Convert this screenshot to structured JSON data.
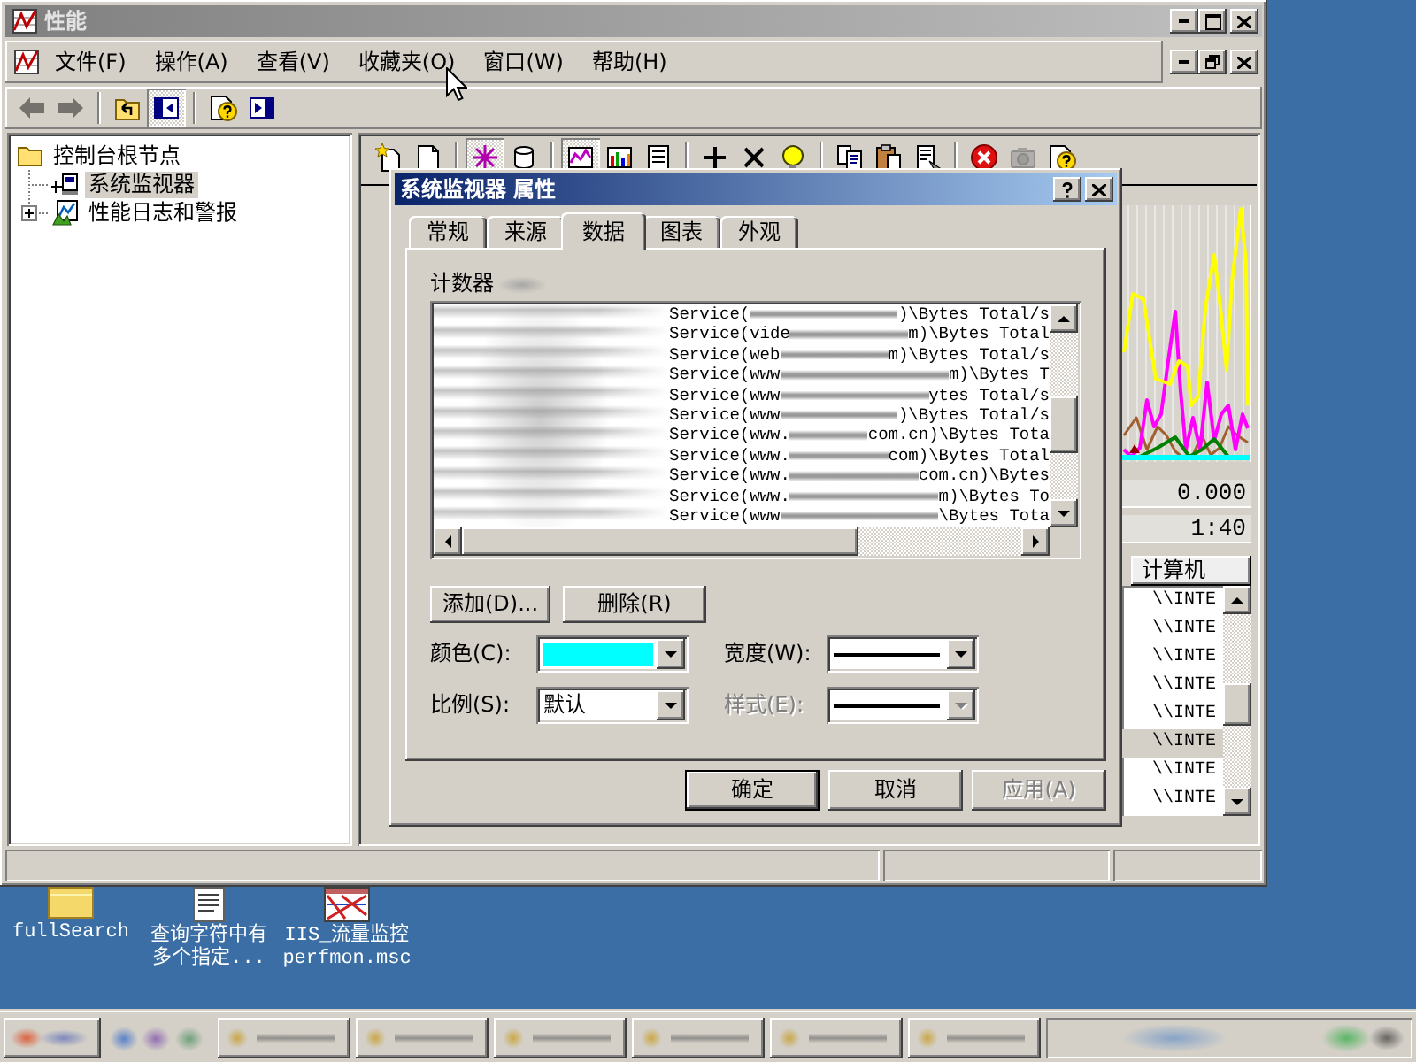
{
  "window": {
    "title": "性能",
    "active": false,
    "menu": [
      "文件(F)",
      "操作(A)",
      "查看(V)",
      "收藏夹(O)",
      "窗口(W)",
      "帮助(H)"
    ],
    "toolbar": [
      [
        {
          "kind": "back",
          "disabled": true,
          "pressed": false
        },
        {
          "kind": "forward",
          "disabled": true,
          "pressed": false
        }
      ],
      [
        {
          "kind": "up",
          "disabled": false,
          "pressed": false
        },
        {
          "kind": "tree",
          "disabled": false,
          "pressed": true
        }
      ],
      [
        {
          "kind": "help",
          "disabled": false,
          "pressed": false
        },
        {
          "kind": "pane",
          "disabled": false,
          "pressed": false
        }
      ]
    ]
  },
  "tree": [
    {
      "kind": "folder",
      "label": "控制台根节点",
      "selected": false,
      "collapsed": false,
      "children": [
        {
          "kind": "monitor",
          "label": "系统监视器",
          "selected": true,
          "collapsed": false
        },
        {
          "kind": "logs",
          "label": "性能日志和警报",
          "selected": false,
          "collapsed": true
        }
      ]
    }
  ],
  "monitor": {
    "toolbar": [
      [
        {
          "kind": "new",
          "disabled": false,
          "pressed": false
        },
        {
          "kind": "clear",
          "disabled": false,
          "pressed": false
        }
      ],
      [
        {
          "kind": "activity",
          "disabled": false,
          "pressed": true
        },
        {
          "kind": "log",
          "disabled": false,
          "pressed": false
        }
      ],
      [
        {
          "kind": "graph",
          "disabled": false,
          "pressed": true
        },
        {
          "kind": "histogram",
          "disabled": false,
          "pressed": false
        },
        {
          "kind": "report",
          "disabled": false,
          "pressed": false
        }
      ],
      [
        {
          "kind": "add",
          "disabled": false,
          "pressed": false
        },
        {
          "kind": "delete",
          "disabled": false,
          "pressed": false
        },
        {
          "kind": "highlight",
          "disabled": false,
          "pressed": false
        }
      ],
      [
        {
          "kind": "copy",
          "disabled": false,
          "pressed": false
        },
        {
          "kind": "paste",
          "disabled": false,
          "pressed": false
        },
        {
          "kind": "properties",
          "disabled": false,
          "pressed": false
        }
      ],
      [
        {
          "kind": "freeze",
          "disabled": false,
          "pressed": false
        },
        {
          "kind": "update",
          "disabled": true,
          "pressed": false
        },
        {
          "kind": "help",
          "disabled": false,
          "pressed": false
        }
      ]
    ],
    "readouts": [
      "0.000",
      "1:40"
    ],
    "legend": {
      "column": "计算机",
      "rows": [
        {
          "computer": "\\\\INTE",
          "selected": false
        },
        {
          "computer": "\\\\INTE",
          "selected": false
        },
        {
          "computer": "\\\\INTE",
          "selected": false
        },
        {
          "computer": "\\\\INTE",
          "selected": false
        },
        {
          "computer": "\\\\INTE",
          "selected": false
        },
        {
          "computer": "\\\\INTE",
          "selected": true
        },
        {
          "computer": "\\\\INTE",
          "selected": false
        },
        {
          "computer": "\\\\INTE",
          "selected": false
        }
      ]
    }
  },
  "dialog": {
    "title": "系统监视器 属性",
    "active": true,
    "tabs": [
      {
        "label": "常规",
        "selected": false
      },
      {
        "label": "来源",
        "selected": false
      },
      {
        "label": "数据",
        "selected": true
      },
      {
        "label": "图表",
        "selected": false
      },
      {
        "label": "外观",
        "selected": false
      }
    ],
    "counters_label": "计数器",
    "counters": [
      {
        "prefix": "Service(",
        "suffix": ")\\Bytes Total/s"
      },
      {
        "prefix": "Service(vide",
        "suffix": "m)\\Bytes Total"
      },
      {
        "prefix": "Service(web",
        "suffix": "m)\\Bytes Total/s"
      },
      {
        "prefix": "Service(www",
        "suffix": "m)\\Bytes T"
      },
      {
        "prefix": "Service(www",
        "suffix": "ytes Total/s"
      },
      {
        "prefix": "Service(www",
        "suffix": ")\\Bytes Total/s"
      },
      {
        "prefix": "Service(www.",
        "suffix": "com.cn)\\Bytes Tota"
      },
      {
        "prefix": "Service(www.",
        "suffix": "com)\\Bytes Total"
      },
      {
        "prefix": "Service(www.",
        "suffix": "com.cn)\\Bytes"
      },
      {
        "prefix": "Service(www.",
        "suffix": "m)\\Bytes To"
      },
      {
        "prefix": "Service(www",
        "suffix": "\\Bytes Tota"
      }
    ],
    "list_buttons": [
      "添加(D)...",
      "删除(R)"
    ],
    "fields": [
      {
        "kind": "color",
        "label": "颜色(C):",
        "color": "#00ffff",
        "disabled": false
      },
      {
        "kind": "line",
        "label": "宽度(W):",
        "disabled": false
      },
      {
        "kind": "text",
        "label": "比例(S):",
        "value": "默认",
        "disabled": false
      },
      {
        "kind": "line",
        "label": "样式(E):",
        "disabled": true
      }
    ],
    "buttons": [
      {
        "label": "确定",
        "default": true,
        "disabled": false
      },
      {
        "label": "取消",
        "default": false,
        "disabled": false
      },
      {
        "label": "应用(A)",
        "default": false,
        "disabled": true
      }
    ]
  },
  "desktop": {
    "icons": [
      {
        "kind": "folder",
        "lines": [
          "fullSearch"
        ]
      },
      {
        "kind": "document",
        "lines": [
          "查询字符中有",
          "多个指定..."
        ]
      },
      {
        "kind": "chart",
        "lines": [
          "IIS_流量监控",
          "perfmon.msc"
        ]
      }
    ],
    "taskbar": [
      {
        "kind": "start"
      },
      {
        "kind": "quick-launch"
      },
      {
        "kind": "window"
      },
      {
        "kind": "window"
      },
      {
        "kind": "window"
      },
      {
        "kind": "window"
      },
      {
        "kind": "window"
      },
      {
        "kind": "window"
      },
      {
        "kind": "tray"
      }
    ]
  }
}
